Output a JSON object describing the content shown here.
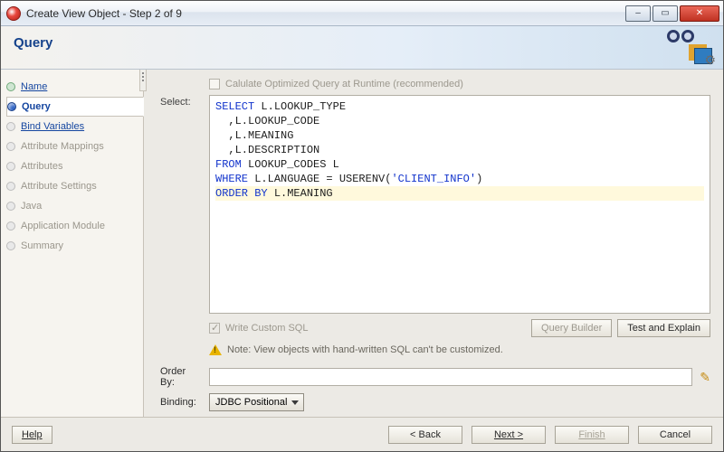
{
  "window": {
    "title": "Create View Object - Step 2 of 9"
  },
  "banner": {
    "title": "Query"
  },
  "sidebar": {
    "items": [
      {
        "label": "Name",
        "state": "done"
      },
      {
        "label": "Query",
        "state": "current"
      },
      {
        "label": "Bind Variables",
        "state": "link"
      },
      {
        "label": "Attribute Mappings",
        "state": "disabled"
      },
      {
        "label": "Attributes",
        "state": "disabled"
      },
      {
        "label": "Attribute Settings",
        "state": "disabled"
      },
      {
        "label": "Java",
        "state": "disabled"
      },
      {
        "label": "Application Module",
        "state": "disabled"
      },
      {
        "label": "Summary",
        "state": "disabled"
      }
    ]
  },
  "query": {
    "optimize_label": "Calulate Optimized Query at Runtime (recommended)",
    "select_label": "Select:",
    "sql": {
      "l1_kw": "SELECT",
      "l1_rest": " L.LOOKUP_TYPE",
      "l2": "  ,L.LOOKUP_CODE",
      "l3": "  ,L.MEANING",
      "l4": "  ,L.DESCRIPTION",
      "l5_kw": "FROM",
      "l5_rest": " LOOKUP_CODES L",
      "l6_kw": "WHERE",
      "l6_rest_a": " L.LANGUAGE = USERENV(",
      "l6_str": "'CLIENT_INFO'",
      "l6_rest_b": ")",
      "l7_kw1": "ORDER",
      "l7_kw2": " BY",
      "l7_rest": " L.MEANING"
    },
    "write_custom_label": "Write Custom SQL",
    "btn_query_builder": "Query Builder",
    "btn_test_explain": "Test and Explain",
    "note": "Note: View objects with hand-written SQL can't be customized.",
    "orderby_label": "Order By:",
    "orderby_value": "",
    "binding_label": "Binding:",
    "binding_value": "JDBC Positional"
  },
  "footer": {
    "help": "Help",
    "back": "< Back",
    "next": "Next >",
    "finish": "Finish",
    "cancel": "Cancel"
  }
}
